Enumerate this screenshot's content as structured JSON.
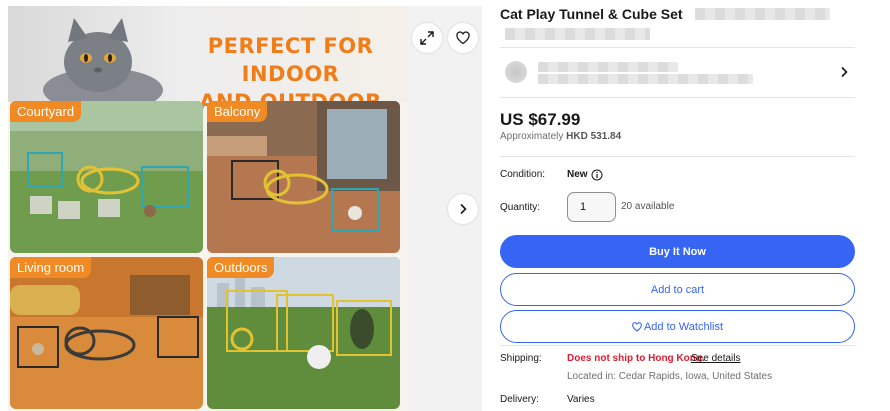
{
  "gallery": {
    "hero_text_line1": "PERFECT FOR INDOOR",
    "hero_text_line2": "AND OUTDOOR USE",
    "tiles": [
      {
        "label": "Courtyard"
      },
      {
        "label": "Balcony"
      },
      {
        "label": "Living room"
      },
      {
        "label": "Outdoors"
      }
    ],
    "icons": {
      "expand": "expand-icon",
      "watch": "heart-icon",
      "next": "chevron-right-icon"
    },
    "colors": {
      "hero_text": "#ef7d1a",
      "tile_label_bg": "#f08a24"
    }
  },
  "listing": {
    "title": "Cat Play Tunnel & Cube Set",
    "seller_chevron_icon": "chevron-right-icon",
    "price": "US $67.99",
    "approx_prefix": "Approximately",
    "approx_value": "HKD 531.84",
    "condition_label": "Condition:",
    "condition_value": "New",
    "condition_info_icon": "info-icon",
    "quantity_label": "Quantity:",
    "quantity_value": "1",
    "available": "20 available",
    "buy_now": "Buy It Now",
    "add_to_cart": "Add to cart",
    "add_to_watchlist": "Add to Watchlist",
    "shipping_label": "Shipping:",
    "shipping_warning": "Does not ship to Hong Kong.",
    "see_details": "See details",
    "located_in": "Located in: Cedar Rapids, Iowa, United States",
    "delivery_label": "Delivery:",
    "delivery_value": "Varies"
  },
  "colors": {
    "accent": "#3665f3",
    "warning": "#dd1e31",
    "text": "#191919",
    "muted": "#707070"
  }
}
